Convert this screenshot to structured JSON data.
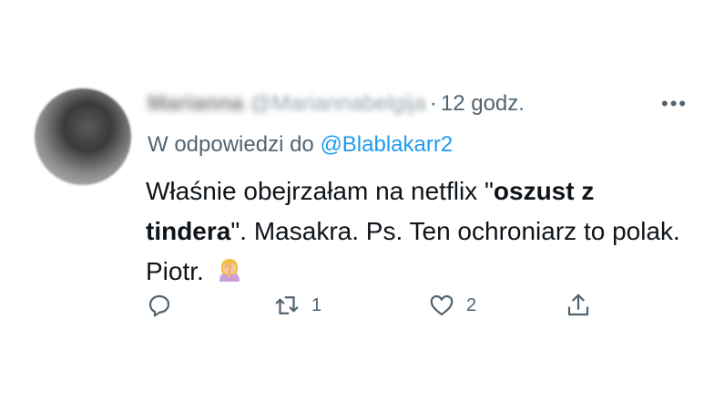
{
  "tweet": {
    "author": {
      "display_name": "Marianna",
      "handle": "@Mariannabelgija",
      "time": "12 godz."
    },
    "reply_prefix": "W odpowiedzi do",
    "reply_to": "@Blablakarr2",
    "text_part1": "Właśnie obejrzałam na netflix \"",
    "text_bold": "oszust z tindera",
    "text_part2": "\". Masakra. Ps. Ten ochroniarz to polak. Piotr.",
    "actions": {
      "reply_count": "",
      "retweet_count": "1",
      "like_count": "2"
    }
  },
  "icons": {
    "more": "more-icon",
    "reply": "reply-icon",
    "retweet": "retweet-icon",
    "like": "heart-icon",
    "share": "share-icon",
    "emoji": "facepalm-emoji"
  },
  "colors": {
    "text": "#0f1419",
    "secondary": "#536471",
    "link": "#1d9bf0"
  }
}
